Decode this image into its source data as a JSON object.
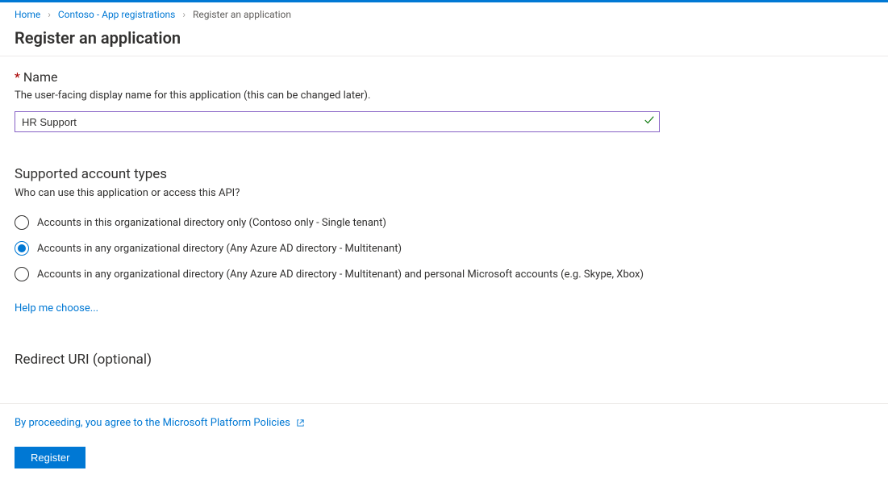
{
  "breadcrumb": {
    "home": "Home",
    "apps": "Contoso - App registrations",
    "current": "Register an application"
  },
  "page_title": "Register an application",
  "name_field": {
    "label": "Name",
    "description": "The user-facing display name for this application (this can be changed later).",
    "value": "HR Support"
  },
  "account_types": {
    "title": "Supported account types",
    "description": "Who can use this application or access this API?",
    "options": [
      "Accounts in this organizational directory only (Contoso only - Single tenant)",
      "Accounts in any organizational directory (Any Azure AD directory - Multitenant)",
      "Accounts in any organizational directory (Any Azure AD directory - Multitenant) and personal Microsoft accounts (e.g. Skype, Xbox)"
    ],
    "selected_index": 1,
    "help_link": "Help me choose..."
  },
  "redirect_uri": {
    "title": "Redirect URI (optional)"
  },
  "footer": {
    "policy_text": "By proceeding, you agree to the Microsoft Platform Policies",
    "register_label": "Register"
  }
}
